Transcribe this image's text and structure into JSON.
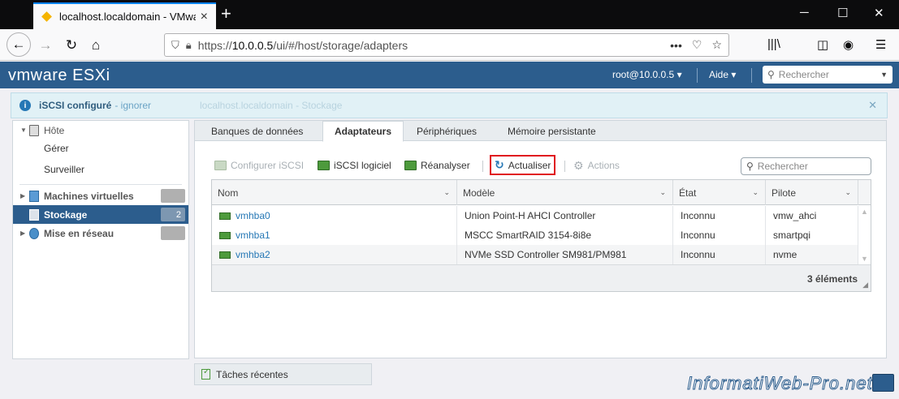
{
  "browser": {
    "tab_title": "localhost.localdomain - VMware ESXi",
    "url_prefix": "https://",
    "url_host": "10.0.0.5",
    "url_path": "/ui/#/host/storage/adapters",
    "new_tab": "+",
    "close_tab": "×",
    "url_more": "•••"
  },
  "esxi": {
    "logo_brand": "vmware",
    "logo_product": "ESXi",
    "user": "root@10.0.0.5 ▾",
    "help": "Aide ▾",
    "search_placeholder": "Rechercher"
  },
  "notification": {
    "message": "iSCSI configuré",
    "ignore": "- ignorer",
    "background_breadcrumb": "localhost.localdomain - Stockage"
  },
  "sidebar": {
    "items": [
      {
        "label": "Hôte",
        "badge": ""
      },
      {
        "label": "Gérer",
        "badge": ""
      },
      {
        "label": "Surveiller",
        "badge": ""
      },
      {
        "label": "Machines virtuelles",
        "badge": ""
      },
      {
        "label": "Stockage",
        "badge": "2"
      },
      {
        "label": "Mise en réseau",
        "badge": ""
      }
    ]
  },
  "tabs": [
    {
      "label": "Banques de données"
    },
    {
      "label": "Adaptateurs"
    },
    {
      "label": "Périphériques"
    },
    {
      "label": "Mémoire persistante"
    }
  ],
  "toolbar": {
    "configure_iscsi": "Configurer iSCSI",
    "software_iscsi": "iSCSI logiciel",
    "rescan": "Réanalyser",
    "refresh": "Actualiser",
    "actions": "Actions",
    "search_placeholder": "Rechercher"
  },
  "grid": {
    "columns": [
      "Nom",
      "Modèle",
      "État",
      "Pilote"
    ],
    "rows": [
      [
        "vmhba0",
        "Union Point-H AHCI Controller",
        "Inconnu",
        "vmw_ahci"
      ],
      [
        "vmhba1",
        "MSCC SmartRAID 3154-8i8e",
        "Inconnu",
        "smartpqi"
      ],
      [
        "vmhba2",
        "NVMe SSD Controller SM981/PM981",
        "Inconnu",
        "nvme"
      ]
    ],
    "count": "3 éléments"
  },
  "recent_tasks": "Tâches récentes",
  "watermark": "InformatiWeb-Pro.net",
  "colors": {
    "header": "#2c5d8d",
    "selected": "#2c5d8d",
    "link": "#2577b5",
    "highlight_border": "#e0161f"
  }
}
